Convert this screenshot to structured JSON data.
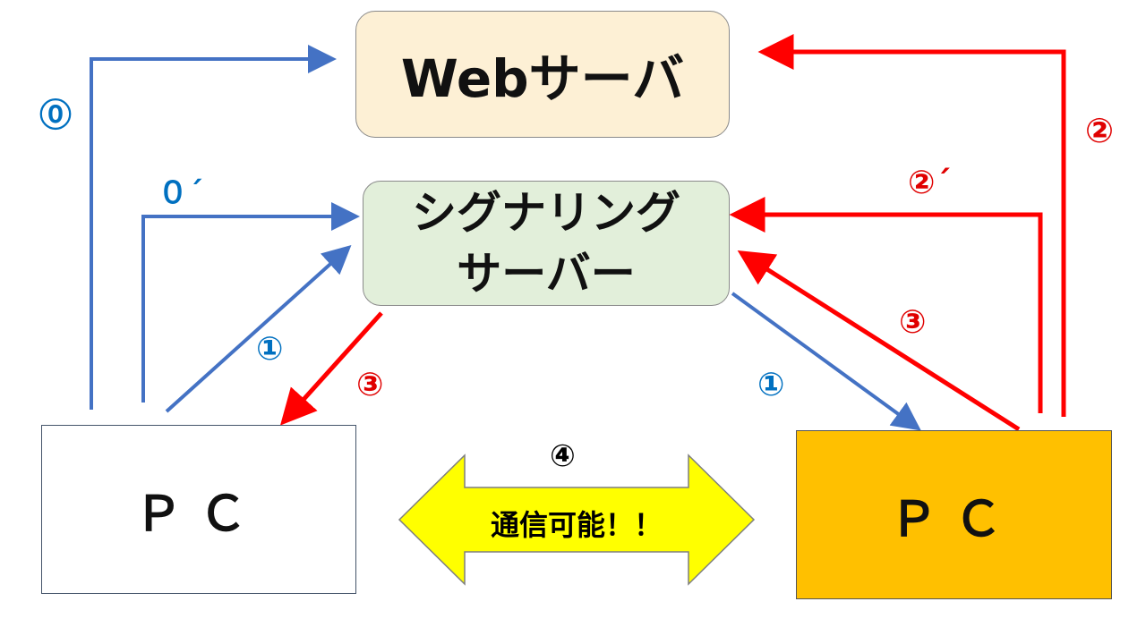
{
  "nodes": {
    "web_server": "Webサーバ",
    "signaling_server_line1": "シグナリング",
    "signaling_server_line2": "サーバー",
    "pc_left": "ＰＣ",
    "pc_right": "ＰＣ"
  },
  "steps": {
    "left_0": "⓪",
    "left_0_prime": "０´",
    "left_1": "①",
    "right_1": "①",
    "left_3": "③",
    "right_3": "③",
    "right_2": "②",
    "right_2_prime": "②´",
    "center_4": "④"
  },
  "center_arrow_label": "通信可能！！",
  "colors": {
    "blue_arrow": "#4472c4",
    "red_arrow": "#ff0000",
    "blue_label": "#0070c0",
    "red_label": "#e00000",
    "web_fill": "#fdf0d5",
    "sig_fill": "#e2efda",
    "pc_right_fill": "#ffc000",
    "center_arrow_fill": "#ffff00"
  }
}
